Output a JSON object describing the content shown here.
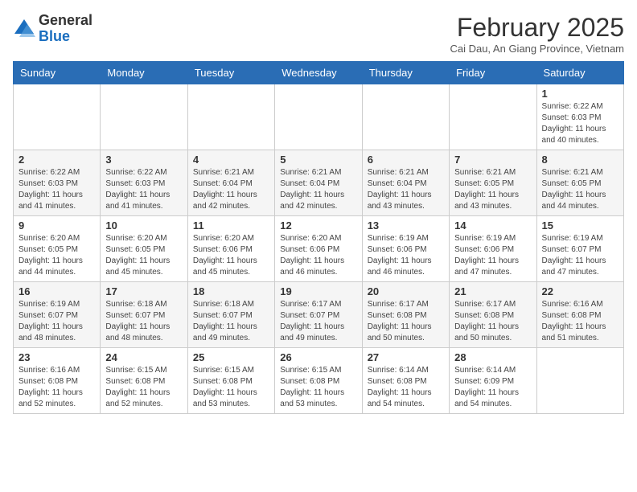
{
  "logo": {
    "general": "General",
    "blue": "Blue"
  },
  "title": "February 2025",
  "subtitle": "Cai Dau, An Giang Province, Vietnam",
  "weekdays": [
    "Sunday",
    "Monday",
    "Tuesday",
    "Wednesday",
    "Thursday",
    "Friday",
    "Saturday"
  ],
  "weeks": [
    [
      {
        "day": "",
        "info": ""
      },
      {
        "day": "",
        "info": ""
      },
      {
        "day": "",
        "info": ""
      },
      {
        "day": "",
        "info": ""
      },
      {
        "day": "",
        "info": ""
      },
      {
        "day": "",
        "info": ""
      },
      {
        "day": "1",
        "info": "Sunrise: 6:22 AM\nSunset: 6:03 PM\nDaylight: 11 hours\nand 40 minutes."
      }
    ],
    [
      {
        "day": "2",
        "info": "Sunrise: 6:22 AM\nSunset: 6:03 PM\nDaylight: 11 hours\nand 41 minutes."
      },
      {
        "day": "3",
        "info": "Sunrise: 6:22 AM\nSunset: 6:03 PM\nDaylight: 11 hours\nand 41 minutes."
      },
      {
        "day": "4",
        "info": "Sunrise: 6:21 AM\nSunset: 6:04 PM\nDaylight: 11 hours\nand 42 minutes."
      },
      {
        "day": "5",
        "info": "Sunrise: 6:21 AM\nSunset: 6:04 PM\nDaylight: 11 hours\nand 42 minutes."
      },
      {
        "day": "6",
        "info": "Sunrise: 6:21 AM\nSunset: 6:04 PM\nDaylight: 11 hours\nand 43 minutes."
      },
      {
        "day": "7",
        "info": "Sunrise: 6:21 AM\nSunset: 6:05 PM\nDaylight: 11 hours\nand 43 minutes."
      },
      {
        "day": "8",
        "info": "Sunrise: 6:21 AM\nSunset: 6:05 PM\nDaylight: 11 hours\nand 44 minutes."
      }
    ],
    [
      {
        "day": "9",
        "info": "Sunrise: 6:20 AM\nSunset: 6:05 PM\nDaylight: 11 hours\nand 44 minutes."
      },
      {
        "day": "10",
        "info": "Sunrise: 6:20 AM\nSunset: 6:05 PM\nDaylight: 11 hours\nand 45 minutes."
      },
      {
        "day": "11",
        "info": "Sunrise: 6:20 AM\nSunset: 6:06 PM\nDaylight: 11 hours\nand 45 minutes."
      },
      {
        "day": "12",
        "info": "Sunrise: 6:20 AM\nSunset: 6:06 PM\nDaylight: 11 hours\nand 46 minutes."
      },
      {
        "day": "13",
        "info": "Sunrise: 6:19 AM\nSunset: 6:06 PM\nDaylight: 11 hours\nand 46 minutes."
      },
      {
        "day": "14",
        "info": "Sunrise: 6:19 AM\nSunset: 6:06 PM\nDaylight: 11 hours\nand 47 minutes."
      },
      {
        "day": "15",
        "info": "Sunrise: 6:19 AM\nSunset: 6:07 PM\nDaylight: 11 hours\nand 47 minutes."
      }
    ],
    [
      {
        "day": "16",
        "info": "Sunrise: 6:19 AM\nSunset: 6:07 PM\nDaylight: 11 hours\nand 48 minutes."
      },
      {
        "day": "17",
        "info": "Sunrise: 6:18 AM\nSunset: 6:07 PM\nDaylight: 11 hours\nand 48 minutes."
      },
      {
        "day": "18",
        "info": "Sunrise: 6:18 AM\nSunset: 6:07 PM\nDaylight: 11 hours\nand 49 minutes."
      },
      {
        "day": "19",
        "info": "Sunrise: 6:17 AM\nSunset: 6:07 PM\nDaylight: 11 hours\nand 49 minutes."
      },
      {
        "day": "20",
        "info": "Sunrise: 6:17 AM\nSunset: 6:08 PM\nDaylight: 11 hours\nand 50 minutes."
      },
      {
        "day": "21",
        "info": "Sunrise: 6:17 AM\nSunset: 6:08 PM\nDaylight: 11 hours\nand 50 minutes."
      },
      {
        "day": "22",
        "info": "Sunrise: 6:16 AM\nSunset: 6:08 PM\nDaylight: 11 hours\nand 51 minutes."
      }
    ],
    [
      {
        "day": "23",
        "info": "Sunrise: 6:16 AM\nSunset: 6:08 PM\nDaylight: 11 hours\nand 52 minutes."
      },
      {
        "day": "24",
        "info": "Sunrise: 6:15 AM\nSunset: 6:08 PM\nDaylight: 11 hours\nand 52 minutes."
      },
      {
        "day": "25",
        "info": "Sunrise: 6:15 AM\nSunset: 6:08 PM\nDaylight: 11 hours\nand 53 minutes."
      },
      {
        "day": "26",
        "info": "Sunrise: 6:15 AM\nSunset: 6:08 PM\nDaylight: 11 hours\nand 53 minutes."
      },
      {
        "day": "27",
        "info": "Sunrise: 6:14 AM\nSunset: 6:08 PM\nDaylight: 11 hours\nand 54 minutes."
      },
      {
        "day": "28",
        "info": "Sunrise: 6:14 AM\nSunset: 6:09 PM\nDaylight: 11 hours\nand 54 minutes."
      },
      {
        "day": "",
        "info": ""
      }
    ]
  ]
}
